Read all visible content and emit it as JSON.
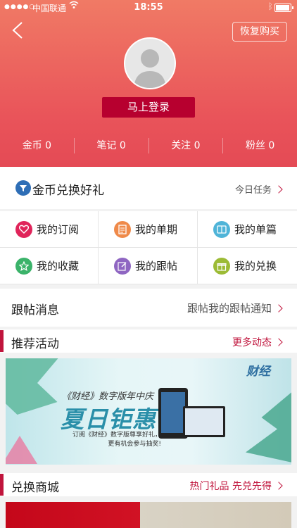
{
  "status_bar": {
    "signal": "●●●●○",
    "carrier": "中国联通",
    "time": "18:55"
  },
  "header": {
    "restore_label": "恢复购买",
    "login_label": "马上登录",
    "stats": [
      {
        "label": "金币 0"
      },
      {
        "label": "笔记 0"
      },
      {
        "label": "关注 0"
      },
      {
        "label": "粉丝 0"
      }
    ]
  },
  "coin_row": {
    "title": "金币兑换好礼",
    "right": "今日任务"
  },
  "menu": [
    {
      "label": "我的订阅",
      "icon": "heart-icon",
      "color": "#e0245a"
    },
    {
      "label": "我的单期",
      "icon": "document-icon",
      "color": "#ef8a4a"
    },
    {
      "label": "我的单篇",
      "icon": "book-icon",
      "color": "#4fb4d8"
    },
    {
      "label": "我的收藏",
      "icon": "star-icon",
      "color": "#3bb36a"
    },
    {
      "label": "我的跟帖",
      "icon": "edit-icon",
      "color": "#8f66c2"
    },
    {
      "label": "我的兑换",
      "icon": "gift-icon",
      "color": "#9cbb35"
    }
  ],
  "follow_row": {
    "title": "跟帖消息",
    "right": "跟帖我的跟帖通知"
  },
  "recommend": {
    "title": "推荐活动",
    "more": "更多动态"
  },
  "banner": {
    "brand": "财经",
    "subtitle": "《财经》数字版年中庆",
    "headline": "夏日钜惠",
    "line1": "订阅《财经》数字版尊享好礼，",
    "line2": "更有机会参与抽奖!"
  },
  "shop": {
    "title": "兑换商城",
    "more": "热门礼品 先兑先得"
  },
  "colors": {
    "accent": "#c0143c",
    "header_top": "#f07a65",
    "header_bottom": "#e44a55"
  }
}
